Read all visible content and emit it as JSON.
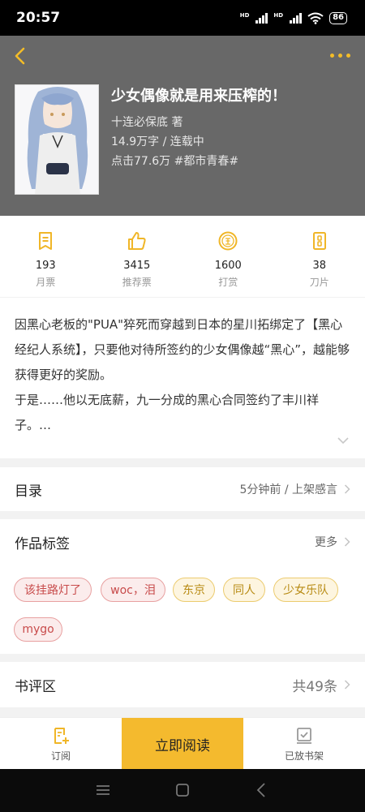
{
  "status": {
    "time": "20:57",
    "battery": "86",
    "network1": "HD",
    "network2": "HD"
  },
  "book": {
    "title": "少女偶像就是用来压榨的！",
    "author": "十连必保底  著",
    "meta": "14.9万字 / 连载中",
    "clicks": "点击77.6万  #都市青春#"
  },
  "stats": [
    {
      "value": "193",
      "label": "月票",
      "icon": "ticket-icon"
    },
    {
      "value": "3415",
      "label": "推荐票",
      "icon": "thumbs-up-icon"
    },
    {
      "value": "1600",
      "label": "打赏",
      "icon": "reward-coin-icon"
    },
    {
      "value": "38",
      "label": "刀片",
      "icon": "blade-icon"
    }
  ],
  "synopsis": "因黑心老板的\"PUA\"猝死而穿越到日本的星川拓绑定了【黑心经纪人系统】，只要他对待所签约的少女偶像越“黑心”，越能够获得更好的奖励。\n于是……他以无底薪，九一分成的黑心合同签约了丰川祥子。…",
  "catalog": {
    "title": "目录",
    "status": "5分钟前 / 上架感言"
  },
  "tags_section": {
    "title": "作品标签",
    "more": "更多"
  },
  "tags": [
    "该挂路灯了",
    "woc，泪",
    "东京",
    "同人",
    "少女乐队",
    "mygo"
  ],
  "reviews": {
    "title": "书评区",
    "count": "共49条"
  },
  "bottom": {
    "subscribe": "订阅",
    "read": "立即阅读",
    "shelf": "已放书架"
  },
  "colors": {
    "accent": "#f4ba2e",
    "hero_bg": "#686868",
    "tag_red": "#c84b4b",
    "tag_yellow": "#b78a12"
  }
}
